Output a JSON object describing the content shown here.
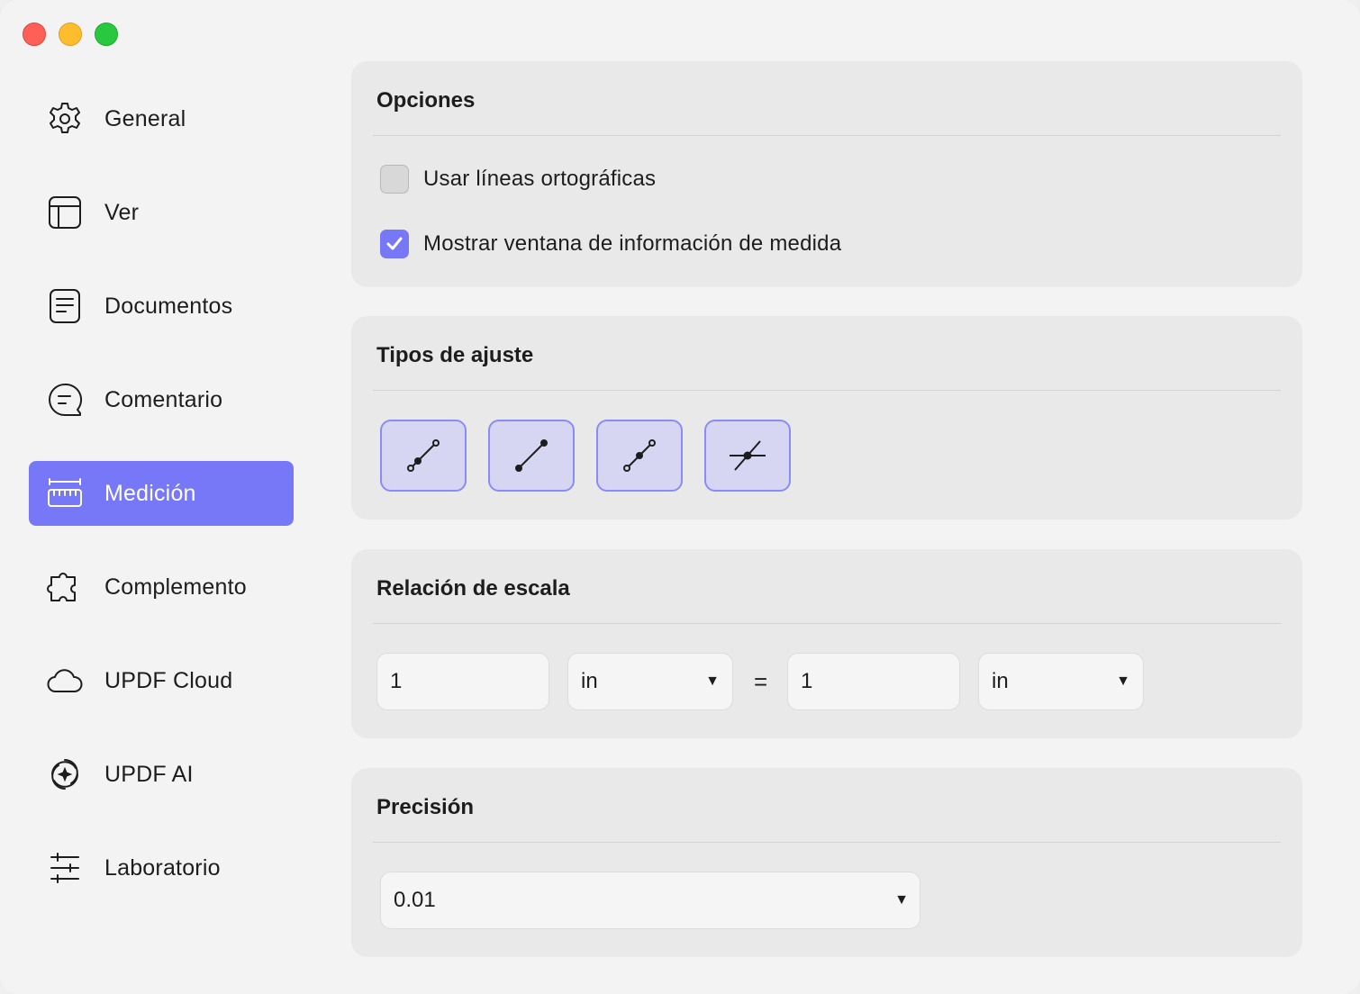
{
  "window": {
    "controls": [
      "close",
      "minimize",
      "zoom"
    ]
  },
  "sidebar": {
    "items": [
      {
        "label": "General",
        "icon": "gear-icon"
      },
      {
        "label": "Ver",
        "icon": "layout-icon"
      },
      {
        "label": "Documentos",
        "icon": "document-icon"
      },
      {
        "label": "Comentario",
        "icon": "comment-icon"
      },
      {
        "label": "Medición",
        "icon": "ruler-icon",
        "active": true
      },
      {
        "label": "Complemento",
        "icon": "puzzle-icon"
      },
      {
        "label": "UPDF Cloud",
        "icon": "cloud-icon"
      },
      {
        "label": "UPDF AI",
        "icon": "ai-icon"
      },
      {
        "label": "Laboratorio",
        "icon": "sliders-icon"
      }
    ]
  },
  "options": {
    "title": "Opciones",
    "orthographic_label": "Usar líneas ortográficas",
    "orthographic_checked": false,
    "show_info_label": "Mostrar ventana de información de medida",
    "show_info_checked": true
  },
  "snap": {
    "title": "Tipos de ajuste",
    "buttons": [
      "snap-to-path-icon",
      "snap-to-endpoint-icon",
      "snap-to-midpoint-icon",
      "snap-to-intersection-icon"
    ]
  },
  "scale": {
    "title": "Relación de escala",
    "left_value": "1",
    "left_unit": "in",
    "equals": "=",
    "right_value": "1",
    "right_unit": "in"
  },
  "precision": {
    "title": "Precisión",
    "value": "0.01"
  },
  "colors": {
    "accent": "#7678f8",
    "snap_bg": "#d6d6f3",
    "panel_bg": "#e9e9e9"
  }
}
